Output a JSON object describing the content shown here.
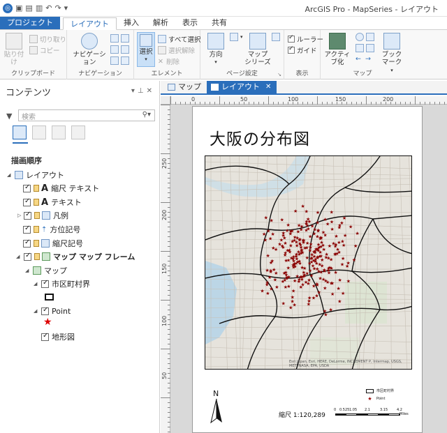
{
  "titlebar": {
    "app_title": "ArcGIS Pro - MapSeries - レイアウト",
    "quick_access": [
      "save",
      "new",
      "open",
      "undo",
      "redo",
      "customize"
    ]
  },
  "ribbon_tabs": [
    "プロジェクト",
    "レイアウト",
    "挿入",
    "解析",
    "表示",
    "共有"
  ],
  "ribbon": {
    "clipboard": {
      "label": "クリップボード",
      "paste": "貼り付け",
      "cut": "切り取り",
      "copy": "コピー"
    },
    "navigation": {
      "label": "ナビゲーション",
      "navigate": "ナビゲーション"
    },
    "elements": {
      "label": "エレメント",
      "select": "選択",
      "select_all": "すべて選択",
      "clear_selection": "選択解除",
      "delete": "削除"
    },
    "page_setup": {
      "label": "ページ設定",
      "orientation": "方向",
      "map_series": "マップ\nシリーズ",
      "map_series_l1": "マップ",
      "map_series_l2": "シリーズ"
    },
    "show": {
      "label": "表示",
      "rulers": "ルーラー",
      "guides": "ガイド"
    },
    "map": {
      "label": "マップ",
      "activate": "アクティブ化",
      "bookmarks_l1": "ブック",
      "bookmarks_l2": "マーク"
    }
  },
  "contents": {
    "title": "コンテンツ",
    "search_placeholder": "検索",
    "drawing_order": "描画順序",
    "tree": [
      {
        "label": "レイアウト",
        "level": 0,
        "bold": false
      },
      {
        "label": "縮尺 テキスト",
        "level": 1,
        "bold": false
      },
      {
        "label": "テキスト",
        "level": 1,
        "bold": false
      },
      {
        "label": "凡例",
        "level": 1,
        "bold": false
      },
      {
        "label": "方位記号",
        "level": 1,
        "bold": false
      },
      {
        "label": "縮尺記号",
        "level": 1,
        "bold": false
      },
      {
        "label": "マップ マップ フレーム",
        "level": 1,
        "bold": true
      },
      {
        "label": "マップ",
        "level": 2,
        "bold": false
      },
      {
        "label": "市区町村界",
        "level": 3,
        "bold": false
      },
      {
        "label": "Point",
        "level": 3,
        "bold": false
      },
      {
        "label": "地形図",
        "level": 3,
        "bold": false
      }
    ]
  },
  "view_tabs": [
    {
      "label": "マップ",
      "active": false
    },
    {
      "label": "レイアウト",
      "active": true
    }
  ],
  "rulers": {
    "top": [
      "0",
      "50",
      "100",
      "150",
      "200"
    ],
    "left": [
      "250",
      "200",
      "150",
      "100",
      "50"
    ]
  },
  "layout": {
    "map_title": "大阪の分布図",
    "scale_text": "縮尺 1:120,289",
    "north_label": "N",
    "scalebar_labels": [
      "0",
      "0.525",
      "1.05",
      "2.1",
      "3.15",
      "4.2"
    ],
    "scalebar_unit": "Miles",
    "legend_items": [
      "市区町村界",
      "Point"
    ],
    "credit": "Esri Japan, Esri, HERE, DeLorme, INCREMENT P, Intermap, USGS, METI/NASA, EPA, USDA"
  },
  "colors": {
    "accent": "#2a6ebb",
    "point_marker": "#b00000"
  }
}
